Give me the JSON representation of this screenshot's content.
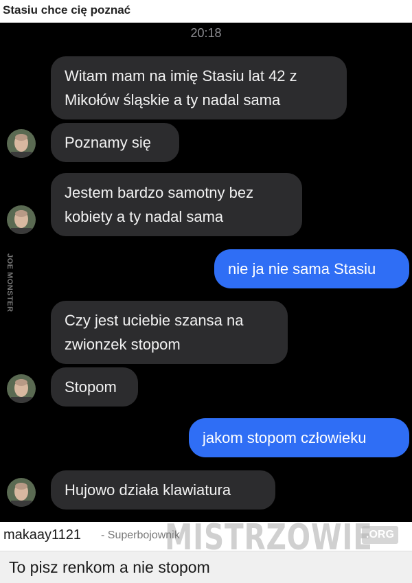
{
  "page": {
    "title": "Stasiu chce cię poznać"
  },
  "chat": {
    "time": "20:18",
    "side_watermark": "JOE MONSTER",
    "messages": [
      {
        "from": "them",
        "line1": "Witam mam na imię Stasiu lat 42 z",
        "line2": "Mikołów śląskie a ty nadal sama"
      },
      {
        "from": "them",
        "line1": "Poznamy się"
      },
      {
        "from": "them",
        "line1": "Jestem bardzo samotny bez",
        "line2": "kobiety a ty nadal sama"
      },
      {
        "from": "me",
        "line1": "nie ja nie sama Stasiu"
      },
      {
        "from": "them",
        "line1": "Czy jest uciebie szansa na",
        "line2": "zwionzek stopom"
      },
      {
        "from": "them",
        "line1": "Stopom"
      },
      {
        "from": "me",
        "line1": "jakom stopom człowieku"
      },
      {
        "from": "them",
        "line1": "Hujowo działa klawiatura"
      }
    ]
  },
  "comment": {
    "username": "makaay1121",
    "rank": "- Superbojownik",
    "brand": "MISTRZOWIE",
    "brand_tld": ".ORG",
    "text": "To pisz renkom a nie stopom"
  },
  "colors": {
    "sent_bubble": "#2f6ef5",
    "received_bubble": "#2c2c2e",
    "chat_bg": "#000000"
  }
}
